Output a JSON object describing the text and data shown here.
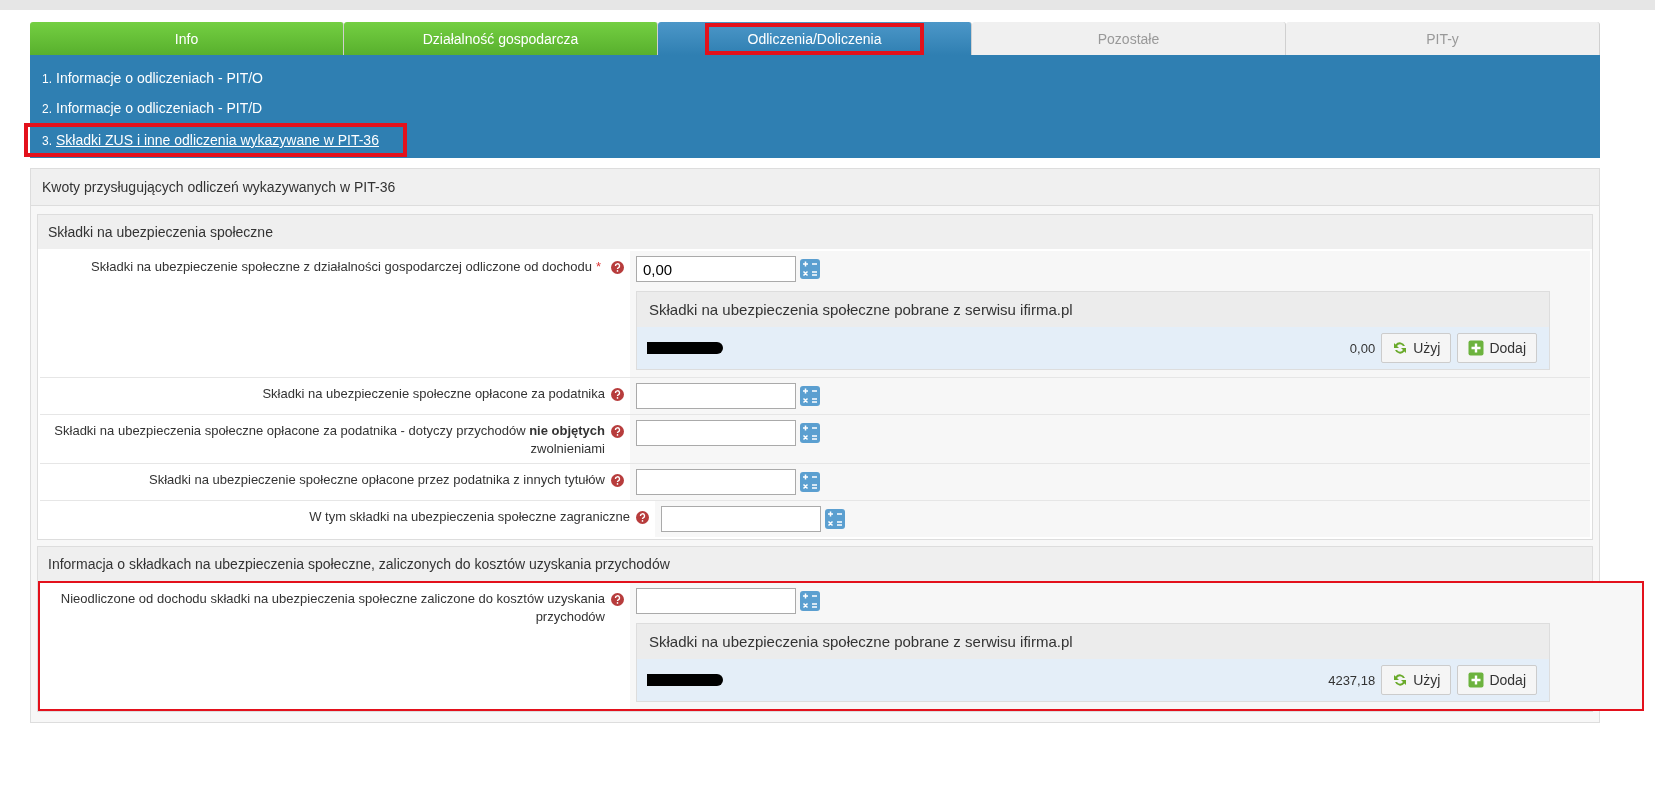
{
  "tabs": [
    {
      "label": "Info",
      "kind": "done",
      "selected": false,
      "highlighted": false
    },
    {
      "label": "Działalność gospodarcza",
      "kind": "done",
      "selected": false,
      "highlighted": false
    },
    {
      "label": "Odliczenia/Doliczenia",
      "kind": "current",
      "selected": true,
      "highlighted": true
    },
    {
      "label": "Pozostałe",
      "kind": "todo",
      "selected": false,
      "highlighted": false
    },
    {
      "label": "PIT-y",
      "kind": "todo",
      "selected": false,
      "highlighted": false
    }
  ],
  "submenu": [
    {
      "number": "1.",
      "label": "Informacje o odliczeniach - PIT/O",
      "selected": false,
      "highlighted": false
    },
    {
      "number": "2.",
      "label": "Informacje o odliczeniach - PIT/D",
      "selected": false,
      "highlighted": false
    },
    {
      "number": "3.",
      "label": "Składki ZUS i inne odliczenia wykazywane w PIT-36",
      "selected": true,
      "highlighted": true
    }
  ],
  "panel": {
    "title": "Kwoty przysługujących odliczeń wykazywanych w PIT-36",
    "sections": [
      {
        "title": "Składki na ubezpieczenia społeczne",
        "highlighted": false,
        "rows": [
          {
            "label": "Składki na ubezpieczenie społeczne z działalności gospodarczej odliczone od dochodu",
            "required_mark": "*",
            "value": "0,00",
            "import": {
              "title": "Składki na ubezpieczenia społeczne pobrane z serwisu ifirma.pl",
              "amount": "0,00",
              "buttons": [
                {
                  "label": "Użyj",
                  "kind": "use"
                },
                {
                  "label": "Dodaj",
                  "kind": "add"
                }
              ]
            }
          },
          {
            "label": "Składki na ubezpieczenie społeczne opłacone za podatnika"
          },
          {
            "label": "Składki na ubezpieczenia społeczne opłacone za podatnika - dotyczy przychodów **nie objętych** zwolnieniami"
          },
          {
            "label": "Składki na ubezpieczenie społeczne opłacone przez podatnika z innych tytułów"
          },
          {
            "label": "W tym składki na ubezpieczenia społeczne zagraniczne",
            "kind": "sub"
          }
        ]
      },
      {
        "title": "Informacja o składkach na ubezpieczenia społeczne, zaliczonych do kosztów uzyskania przychodów",
        "highlighted": true,
        "rows": [
          {
            "label": "Nieodliczone od dochodu składki na ubezpieczenia społeczne zaliczone do kosztów uzyskania przychodów",
            "import": {
              "title": "Składki na ubezpieczenia społeczne pobrane z serwisu ifirma.pl",
              "amount": "4237,18",
              "buttons": [
                {
                  "label": "Użyj",
                  "kind": "use"
                },
                {
                  "label": "Dodaj",
                  "kind": "add"
                }
              ]
            }
          }
        ]
      }
    ]
  }
}
